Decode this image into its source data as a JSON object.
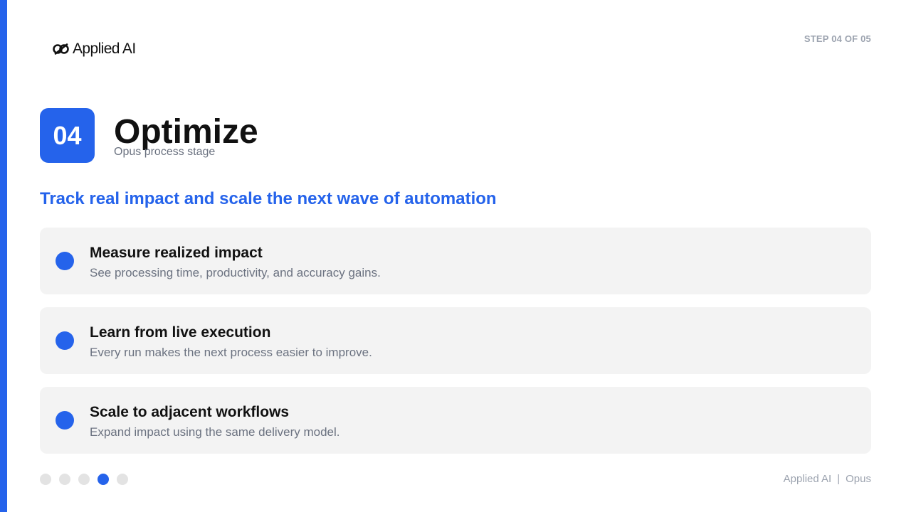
{
  "brand": {
    "logo_text": "Applied AI"
  },
  "step_indicator": "STEP 04 OF 05",
  "stage": {
    "number": "04",
    "title": "Optimize",
    "subtitle": "Opus process stage"
  },
  "tagline": "Track real impact and scale the next wave of automation",
  "cards": [
    {
      "title": "Measure realized impact",
      "description": "See processing time, productivity, and accuracy gains."
    },
    {
      "title": "Learn from live execution",
      "description": "Every run makes the next process easier to improve."
    },
    {
      "title": "Scale to adjacent workflows",
      "description": "Expand impact using the same delivery model."
    }
  ],
  "pagination": {
    "total": 5,
    "current": 4
  },
  "footer": {
    "company": "Applied AI",
    "separator": "|",
    "product": "Opus"
  },
  "colors": {
    "accent": "#2563eb",
    "card_bg": "#f3f3f3",
    "muted_text": "#6b7280"
  }
}
